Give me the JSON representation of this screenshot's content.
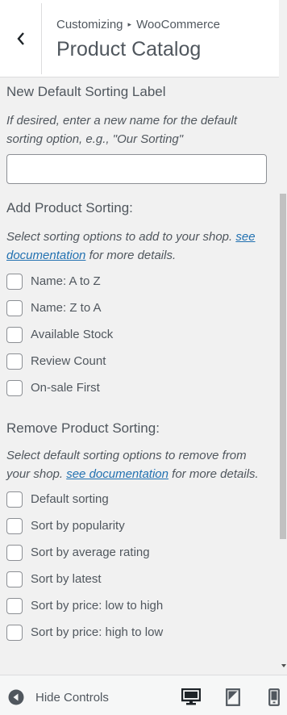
{
  "header": {
    "breadcrumb_parent": "Customizing",
    "breadcrumb_separator": "▸",
    "breadcrumb_current": "WooCommerce",
    "title": "Product Catalog"
  },
  "default_label": {
    "title": "New Default Sorting Label",
    "description": "If desired, enter a new name for the default sorting option, e.g., \"Our Sorting\"",
    "value": "",
    "placeholder": ""
  },
  "add_sorting": {
    "title": "Add Product Sorting:",
    "description_prefix": "Select sorting options to add to your shop.",
    "link_text": "see documentation",
    "description_suffix": "for more details.",
    "options": [
      "Name: A to Z",
      "Name: Z to A",
      "Available Stock",
      "Review Count",
      "On-sale First"
    ]
  },
  "remove_sorting": {
    "title": "Remove Product Sorting:",
    "description_prefix": "Select default sorting options to remove from your shop.",
    "link_text": "see documentation",
    "description_suffix": "for more details.",
    "options": [
      "Default sorting",
      "Sort by popularity",
      "Sort by average rating",
      "Sort by latest",
      "Sort by price: low to high",
      "Sort by price: high to low"
    ]
  },
  "footer": {
    "hide_controls_label": "Hide Controls",
    "devices": [
      "desktop-icon",
      "tablet-icon",
      "mobile-icon"
    ],
    "active_device": "desktop-icon"
  },
  "colors": {
    "link": "#2271b1",
    "text": "#50575e",
    "active_icon": "#1d2327"
  }
}
